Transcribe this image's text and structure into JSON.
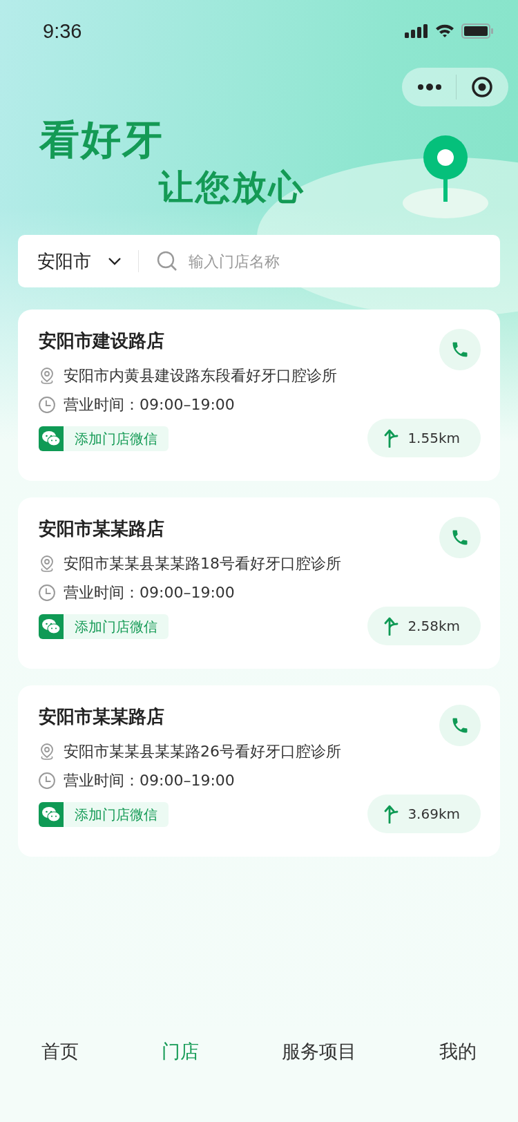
{
  "status_bar": {
    "time": "9:36"
  },
  "hero": {
    "title": "看好牙",
    "subtitle": "让您放心"
  },
  "search": {
    "city": "安阳市",
    "placeholder": "输入门店名称"
  },
  "stores": [
    {
      "name": "安阳市建设路店",
      "address": "安阳市内黄县建设路东段看好牙口腔诊所",
      "hours": "营业时间：09:00–19:00",
      "wechat": "添加门店微信",
      "distance": "1.55km"
    },
    {
      "name": "安阳市某某路店",
      "address": "安阳市某某县某某路18号看好牙口腔诊所",
      "hours": "营业时间：09:00–19:00",
      "wechat": "添加门店微信",
      "distance": "2.58km"
    },
    {
      "name": "安阳市某某路店",
      "address": "安阳市某某县某某路26号看好牙口腔诊所",
      "hours": "营业时间：09:00–19:00",
      "wechat": "添加门店微信",
      "distance": "3.69km"
    }
  ],
  "tabs": [
    {
      "label": "首页",
      "selected": false
    },
    {
      "label": "门店",
      "selected": true
    },
    {
      "label": "服务项目",
      "selected": false
    },
    {
      "label": "我的",
      "selected": false
    }
  ]
}
